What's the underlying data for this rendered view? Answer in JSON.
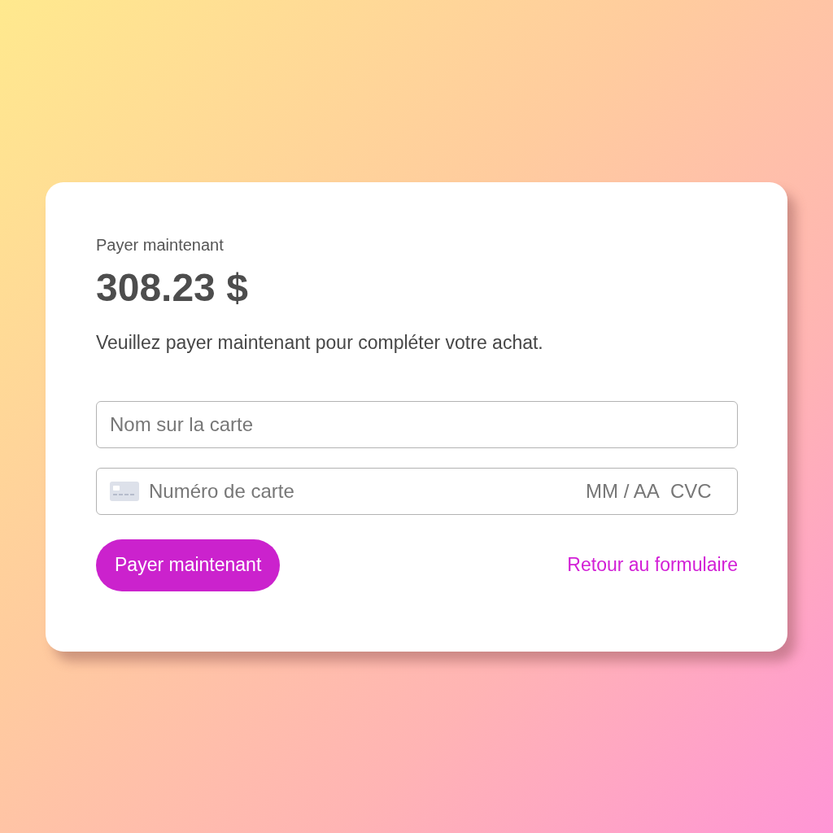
{
  "header": {
    "label": "Payer maintenant",
    "amount": "308.23 $"
  },
  "description": "Veuillez payer maintenant pour compléter votre achat.",
  "fields": [
    {
      "kind": "name",
      "placeholder": "Nom sur la carte"
    },
    {
      "kind": "card",
      "placeholder": "Numéro de carte",
      "expiry_placeholder": "MM / AA",
      "cvc_placeholder": "CVC"
    }
  ],
  "actions": {
    "button": "Payer maintenant",
    "link": "Retour au formulaire"
  }
}
